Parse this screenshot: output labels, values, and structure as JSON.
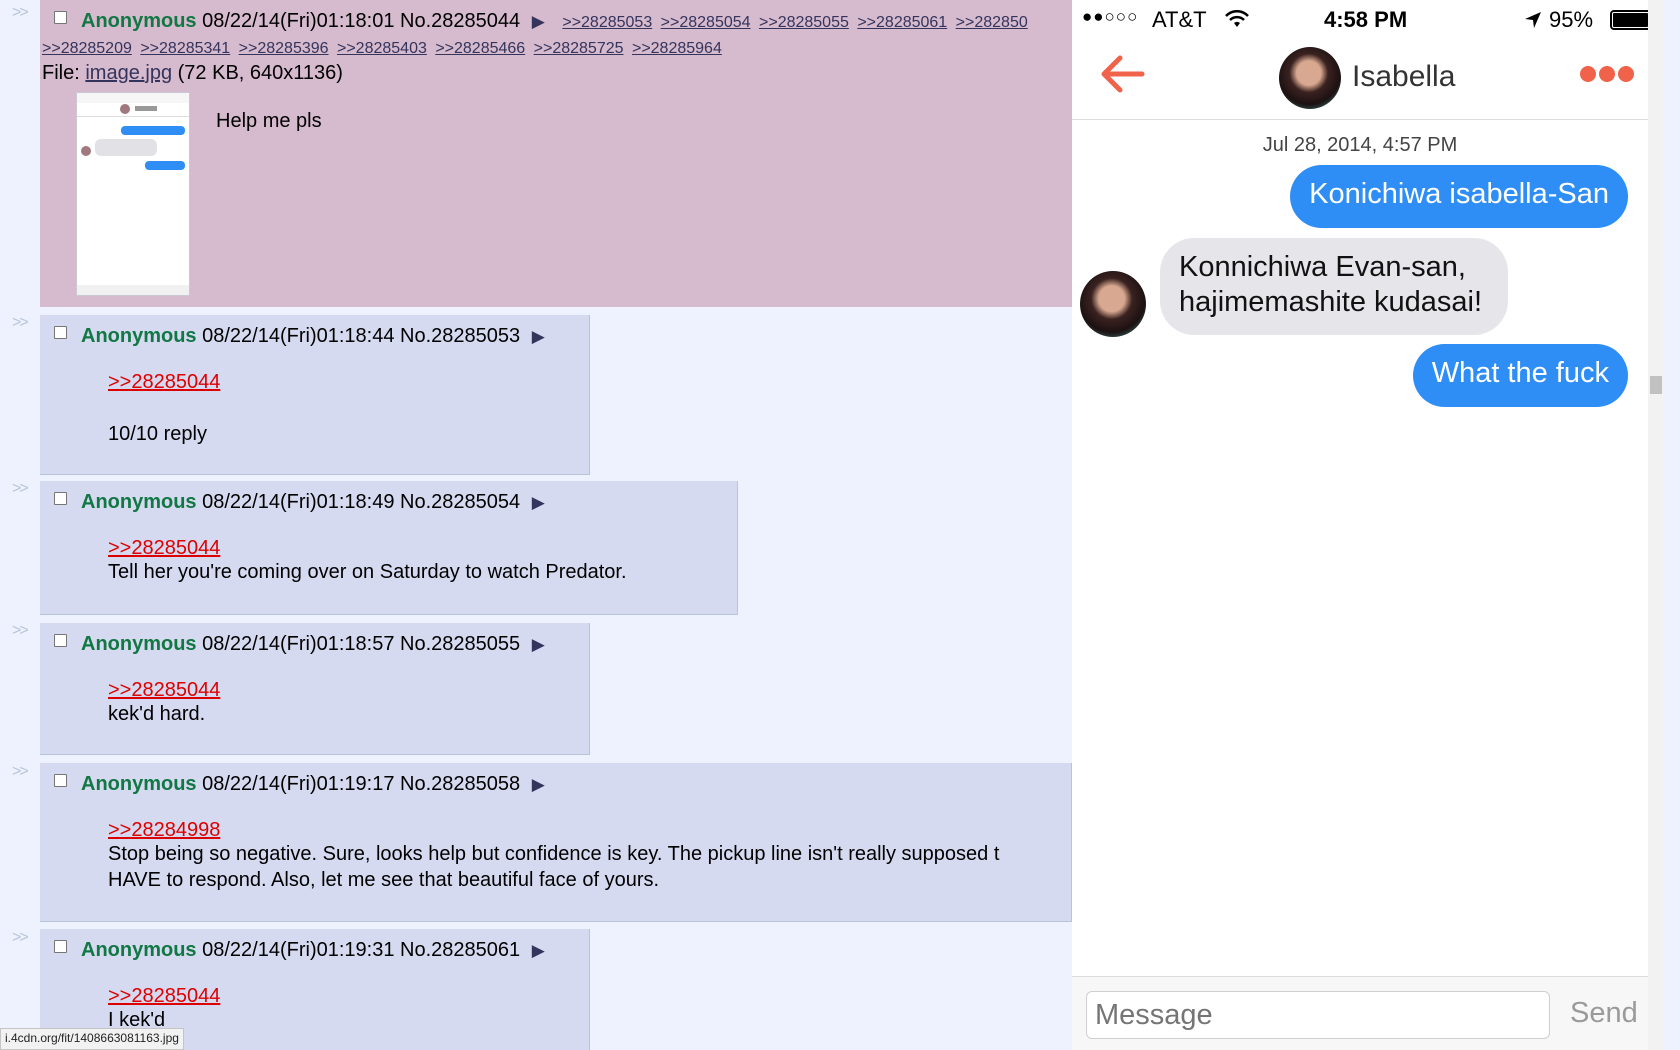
{
  "op": {
    "name": "Anonymous",
    "datetime": "08/22/14(Fri)01:18:01",
    "no": "No.28285044",
    "quote_links_row1": [
      ">>28285053",
      ">>28285054",
      ">>28285055",
      ">>28285061",
      ">>282850"
    ],
    "quote_links_row2": [
      ">>28285209",
      ">>28285341",
      ">>28285396",
      ">>28285403",
      ">>28285466",
      ">>28285725",
      ">>28285964"
    ],
    "file_label": "File:",
    "file_name": "image.jpg",
    "file_info": "(72 KB, 640x1136)",
    "text": "Help me pls"
  },
  "replies": [
    {
      "name": "Anonymous",
      "datetime": "08/22/14(Fri)01:18:44",
      "no": "No.28285053",
      "quote": ">>28285044",
      "lines": [
        "10/10 reply"
      ]
    },
    {
      "name": "Anonymous",
      "datetime": "08/22/14(Fri)01:18:49",
      "no": "No.28285054",
      "quote": ">>28285044",
      "lines": [
        "Tell her you're coming over on Saturday to watch Predator."
      ]
    },
    {
      "name": "Anonymous",
      "datetime": "08/22/14(Fri)01:18:57",
      "no": "No.28285055",
      "quote": ">>28285044",
      "lines": [
        "kek'd hard."
      ]
    },
    {
      "name": "Anonymous",
      "datetime": "08/22/14(Fri)01:19:17",
      "no": "No.28285058",
      "quote": ">>28284998",
      "lines": [
        "Stop being so negative. Sure, looks help but confidence is key. The pickup line isn't really supposed t",
        "HAVE to respond. Also, let me see that beautiful face of yours."
      ]
    },
    {
      "name": "Anonymous",
      "datetime": "08/22/14(Fri)01:19:31",
      "no": "No.28285061",
      "quote": ">>28285044",
      "lines": [
        "I kek'd"
      ]
    }
  ],
  "side_marker": ">>",
  "status_url": "i.4cdn.org/fit/1408663081163.jpg",
  "phone": {
    "carrier": "AT&T",
    "time": "4:58 PM",
    "battery": "95%",
    "contact_name": "Isabella",
    "timestamp": "Jul 28, 2014, 4:57 PM",
    "messages": [
      {
        "from": "me",
        "text": "Konichiwa isabella-San"
      },
      {
        "from": "them",
        "text": "Konnichiwa Evan-san, hajimemashite kudasai!"
      },
      {
        "from": "me",
        "text": "What the fuck"
      }
    ],
    "input_placeholder": "Message",
    "send_label": "Send",
    "accent_color": "#f0624a",
    "bubble_color": "#2e8ef6"
  }
}
